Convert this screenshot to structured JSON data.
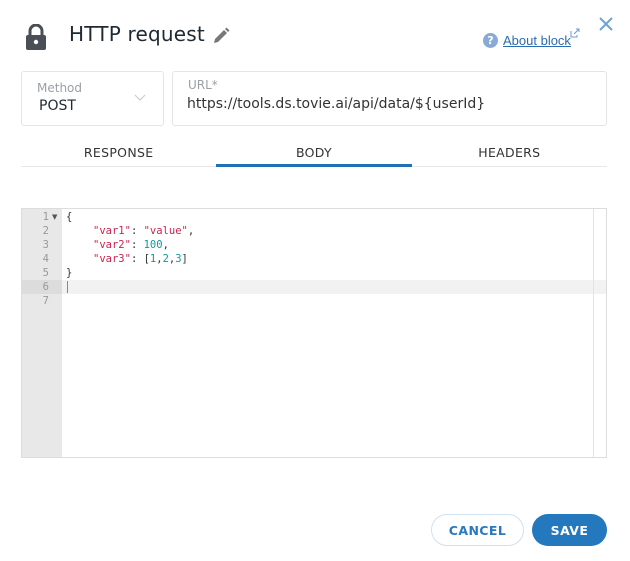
{
  "header": {
    "title": "HTTP request",
    "icon": "lock-icon",
    "edit_icon": "pencil-icon",
    "about_link": "About block",
    "close_icon": "close-icon"
  },
  "method": {
    "label": "Method",
    "value": "POST"
  },
  "url": {
    "label": "URL*",
    "value": "https://tools.ds.tovie.ai/api/data/${userId}"
  },
  "tabs": [
    {
      "label": "RESPONSE",
      "active": false
    },
    {
      "label": "BODY",
      "active": true
    },
    {
      "label": "HEADERS",
      "active": false
    }
  ],
  "editor": {
    "line_numbers": [
      "1",
      "2",
      "3",
      "4",
      "5",
      "6",
      "7"
    ],
    "active_line": 6,
    "lines": {
      "l1": "{",
      "l2_key": "\"var1\"",
      "l2_sep": ": ",
      "l2_val": "\"value\"",
      "l2_end": ",",
      "l3_key": "\"var2\"",
      "l3_sep": ": ",
      "l3_val": "100",
      "l3_end": ",",
      "l4_key": "\"var3\"",
      "l4_sep": ": [",
      "l4_v1": "1",
      "l4_v2": "2",
      "l4_v3": "3",
      "l4_comma": ",",
      "l4_end": "]",
      "l5": "}"
    }
  },
  "footer": {
    "cancel_label": "CANCEL",
    "save_label": "SAVE"
  },
  "colors": {
    "accent": "#2478bd",
    "tab_indicator": "#2170b5",
    "json_string": "#c7254e",
    "json_number": "#0e9a9a"
  }
}
